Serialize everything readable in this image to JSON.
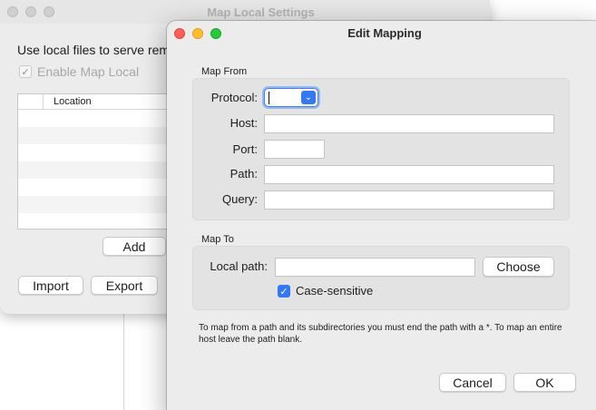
{
  "back_window": {
    "title": "Map Local Settings",
    "description": "Use local files to serve rem",
    "enable_label": "Enable Map Local",
    "table_header": "Location",
    "add_button": "Add",
    "import_button": "Import",
    "export_button": "Export"
  },
  "dialog": {
    "title": "Edit Mapping",
    "map_from": {
      "section_label": "Map From",
      "protocol_label": "Protocol:",
      "protocol_value": "",
      "host_label": "Host:",
      "host_value": "",
      "port_label": "Port:",
      "port_value": "",
      "path_label": "Path:",
      "path_value": "",
      "query_label": "Query:",
      "query_value": ""
    },
    "map_to": {
      "section_label": "Map To",
      "local_path_label": "Local path:",
      "local_path_value": "",
      "choose_button": "Choose",
      "case_sensitive_label": "Case-sensitive",
      "case_sensitive_checked": true
    },
    "note": "To map from a path and its subdirectories you must end the path with a *. To map an entire host leave the path blank.",
    "cancel_button": "Cancel",
    "ok_button": "OK"
  },
  "colors": {
    "accent": "#3478f6",
    "close": "#ff5f57",
    "minimize": "#febc2e",
    "maximize": "#28c840"
  }
}
